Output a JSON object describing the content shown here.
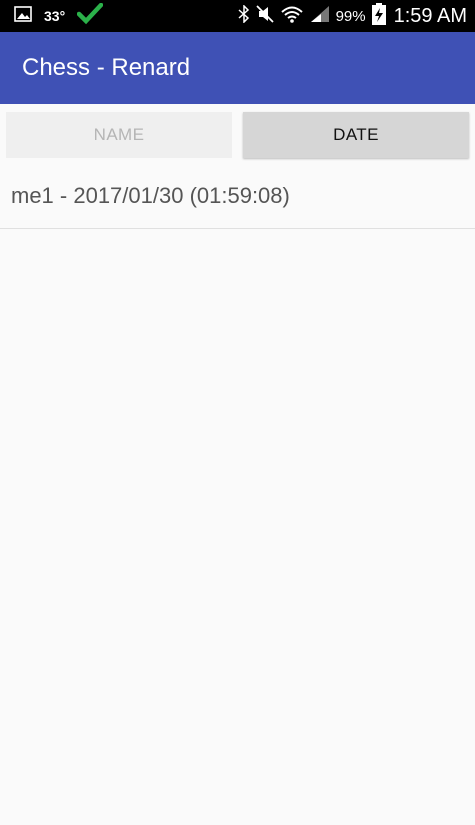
{
  "status_bar": {
    "temperature": "33°",
    "battery": "99%",
    "time": "1:59 AM",
    "icons": [
      "gallery-icon",
      "check-icon",
      "bluetooth-icon",
      "mute-icon",
      "wifi-icon",
      "signal-icon",
      "battery-charging-icon"
    ]
  },
  "app_bar": {
    "title": "Chess - Renard",
    "color": "#3f51b5"
  },
  "sort": {
    "name_label": "NAME",
    "date_label": "DATE",
    "active": "date"
  },
  "games": [
    {
      "label": "me1 - 2017/01/30 (01:59:08)"
    }
  ]
}
